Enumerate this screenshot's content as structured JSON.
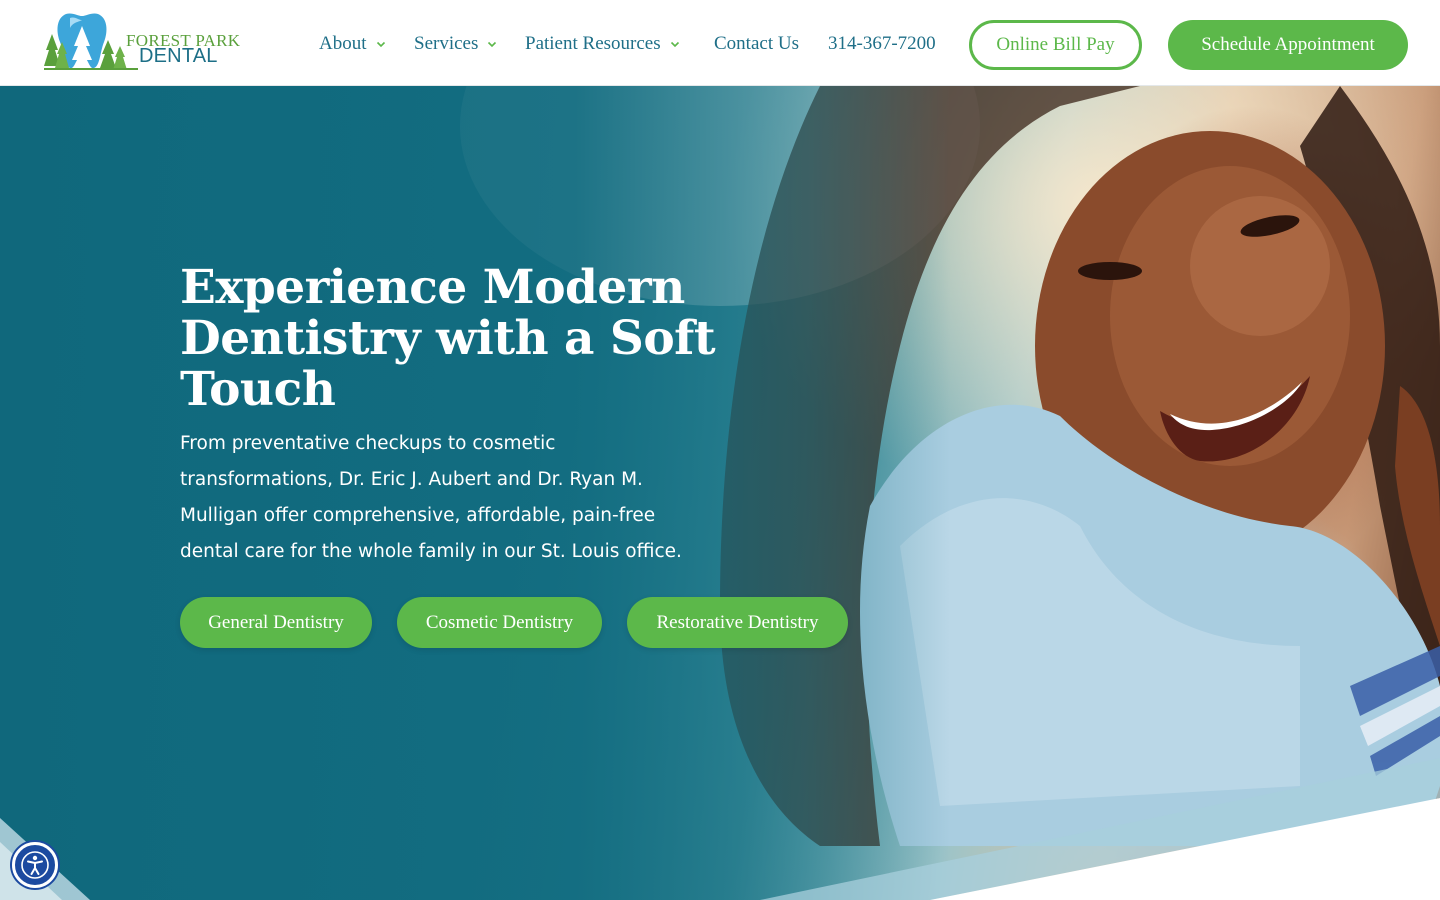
{
  "brand": {
    "name_line1": "FOREST PARK",
    "name_line2": "DENTAL",
    "primary_color": "#1f6f88",
    "accent_color": "#5cb84a"
  },
  "nav": {
    "items": [
      {
        "label": "About",
        "has_dropdown": true
      },
      {
        "label": "Services",
        "has_dropdown": true
      },
      {
        "label": "Patient Resources",
        "has_dropdown": true
      },
      {
        "label": "Contact Us",
        "has_dropdown": false
      },
      {
        "label": "314-367-7200",
        "has_dropdown": false
      }
    ],
    "bill_pay_label": "Online Bill Pay",
    "schedule_label": "Schedule Appointment"
  },
  "hero": {
    "title": "Experience Modern Dentistry with a Soft Touch",
    "description": "From preventative checkups to cosmetic transformations, Dr. Eric J. Aubert and Dr. Ryan M. Mulligan offer comprehensive, affordable, pain-free dental care for the whole family in our St. Louis office.",
    "buttons": [
      {
        "label": "General Dentistry"
      },
      {
        "label": "Cosmetic Dentistry"
      },
      {
        "label": "Restorative Dentistry"
      }
    ]
  },
  "accessibility": {
    "icon": "accessibility-icon"
  }
}
